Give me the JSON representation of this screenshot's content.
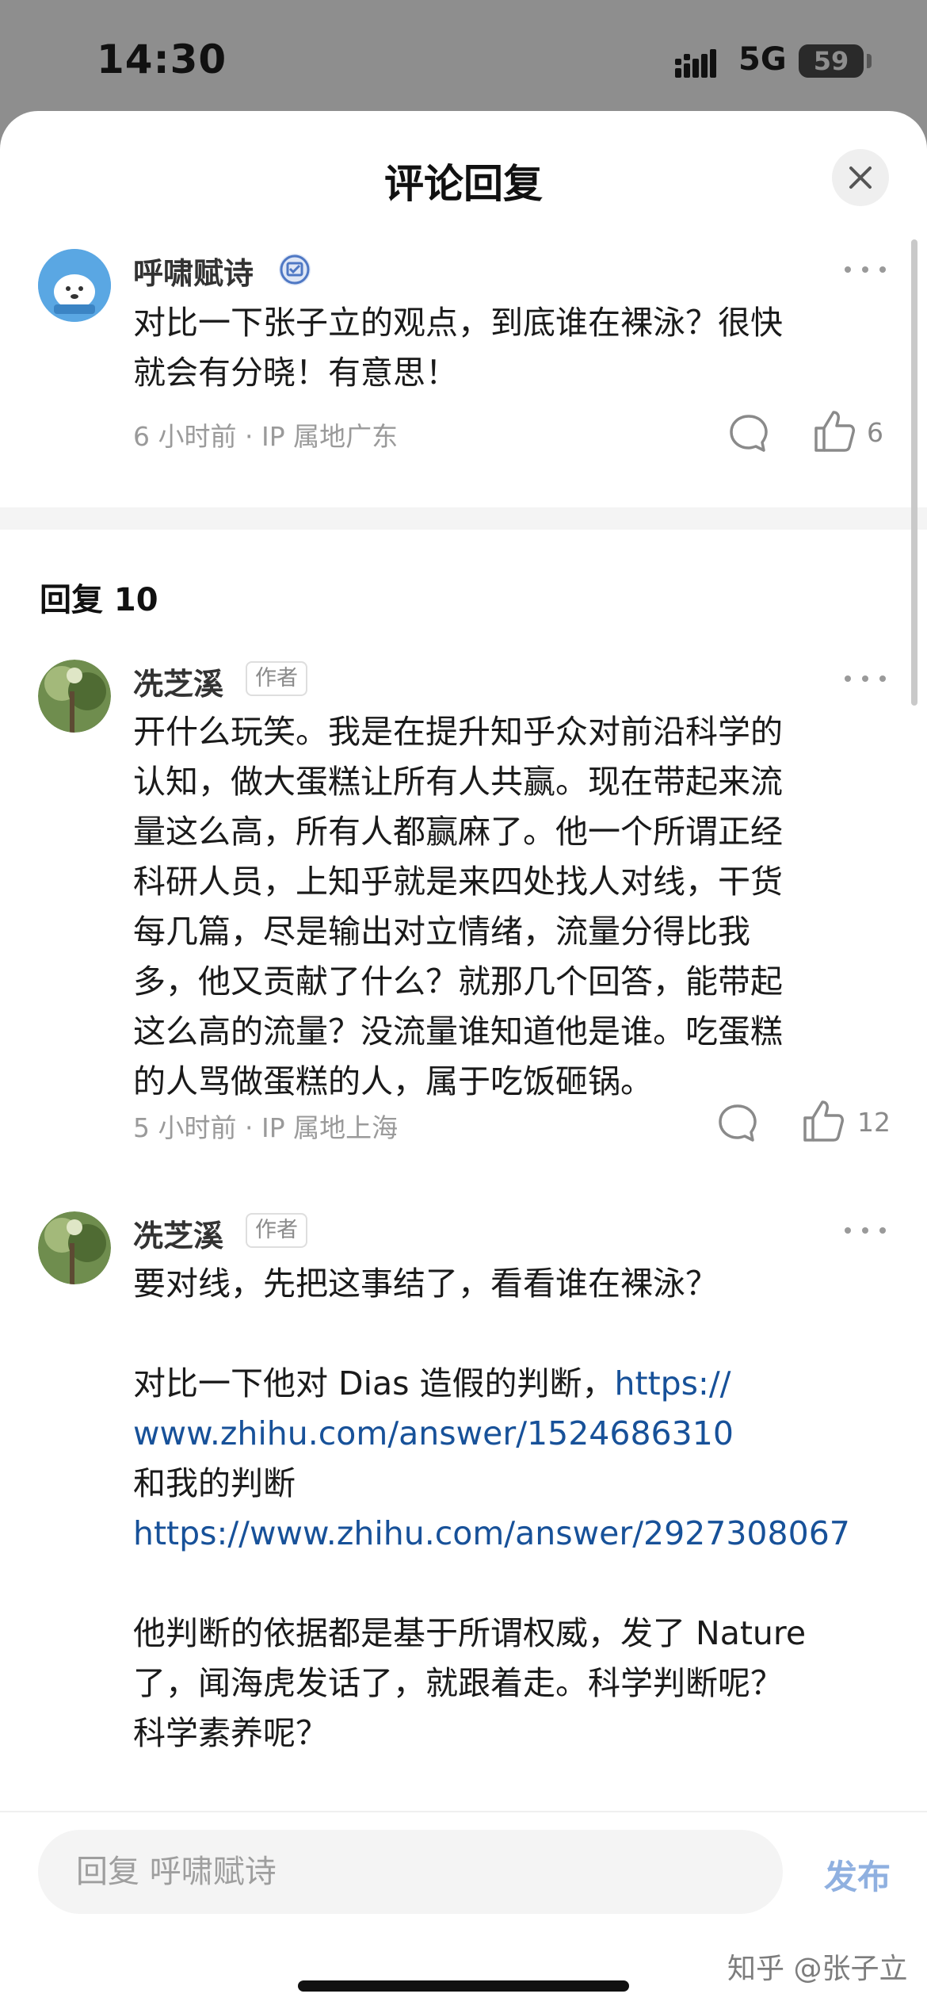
{
  "status_bar": {
    "time": "14:30",
    "network": "5G",
    "battery": "59"
  },
  "header": {
    "title": "评论回复"
  },
  "main_comment": {
    "author": "呼啸赋诗",
    "text": "对比一下张子立的观点，到底谁在裸泳？很快\n就会有分晓！有意思！",
    "time": "6 小时前",
    "location": "IP 属地广东",
    "like_count": "6"
  },
  "replies_header": "回复 10",
  "replies": [
    {
      "author": "冼芝溪",
      "tag": "作者",
      "text": "开什么玩笑。我是在提升知乎众对前沿科学的\n认知，做大蛋糕让所有人共赢。现在带起来流\n量这么高，所有人都赢麻了。他一个所谓正经\n科研人员，上知乎就是来四处找人对线，干货\n每几篇，尽是输出对立情绪，流量分得比我\n多，他又贡献了什么？就那几个回答，能带起\n这么高的流量？没流量谁知道他是谁。吃蛋糕\n的人骂做蛋糕的人，属于吃饭砸锅。",
      "time": "5 小时前",
      "location": "IP 属地上海",
      "like_count": "12"
    },
    {
      "author": "冼芝溪",
      "tag": "作者",
      "line1": "要对线，先把这事结了，看看谁在裸泳？",
      "line2_prefix": "对比一下他对 Dias 造假的判断，",
      "link1_part1": "https://",
      "link1_part2": "www.zhihu.com/answer/1524686310",
      "line3": "和我的判断",
      "link2": "https://www.zhihu.com/answer/2927308067",
      "line4": "他判断的依据都是基于所谓权威，发了 Nature",
      "line5": "了，闻海虎发话了，就跟着走。科学判断呢？",
      "line6": "科学素养呢？"
    }
  ],
  "bottom_bar": {
    "reply_placeholder": "回复 呼啸赋诗",
    "publish_label": "发布",
    "watermark": "知乎 @张子立"
  },
  "colors": {
    "link": "#175199",
    "publish": "#8fb0e0",
    "sheet": "#ffffff",
    "backdrop": "#8e8e8e"
  },
  "icons": [
    "signal-icon",
    "battery-icon",
    "close-icon",
    "verified-badge-icon",
    "more-icon",
    "comment-icon",
    "like-icon"
  ]
}
